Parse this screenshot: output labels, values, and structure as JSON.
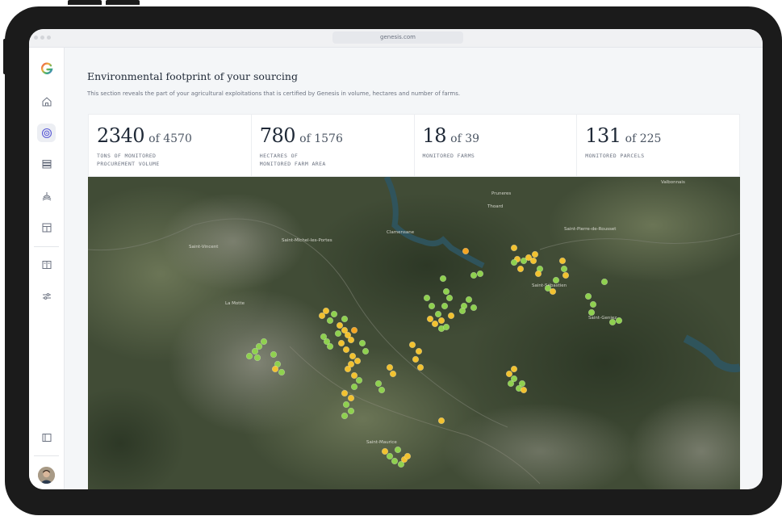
{
  "browser": {
    "url": "genesis.com"
  },
  "brand": {
    "logo": "G",
    "colors": [
      "#e84e4e",
      "#f2b33d",
      "#3bb36b",
      "#4a7bd6"
    ]
  },
  "sidebar": {
    "items": [
      {
        "name": "home",
        "icon": "home-icon",
        "active": false
      },
      {
        "name": "sourcing",
        "icon": "target-icon",
        "active": true
      },
      {
        "name": "suppliers",
        "icon": "list-icon",
        "active": false
      },
      {
        "name": "farms",
        "icon": "field-icon",
        "active": false
      },
      {
        "name": "calendar",
        "icon": "calendar-icon",
        "active": false
      },
      {
        "name": "book",
        "icon": "book-icon",
        "active": false
      },
      {
        "name": "settings",
        "icon": "sliders-icon",
        "active": false
      }
    ],
    "bottom": {
      "collapse_icon": "panel-icon",
      "avatar": "user-avatar"
    }
  },
  "page": {
    "title": "Environmental footprint of your sourcing",
    "subtitle": "This section reveals the part of your agricultural exploitations that is certified by Genesis in volume, hectares and number of farms."
  },
  "stats": [
    {
      "value": "2340",
      "total": "of 4570",
      "label1": "TONS OF MONITORED",
      "label2": "PROCUREMENT VOLUME"
    },
    {
      "value": "780",
      "total": "of 1576",
      "label1": "HECTARES OF",
      "label2": "MONITORED FARM AREA"
    },
    {
      "value": "18",
      "total": "of 39",
      "label1": "MONITORED FARMS",
      "label2": ""
    },
    {
      "value": "131",
      "total": "of 225",
      "label1": "MONITORED PARCELS",
      "label2": ""
    }
  ],
  "map": {
    "colors": {
      "green": "#8fd14f",
      "yellow": "#f2c230",
      "orange": "#f5a623"
    },
    "labels": [
      "Pruneres",
      "Saint-Pierre-de-Rousset",
      "Saint-Michel-les-Portes",
      "Saint-Sébastien",
      "Clamensane",
      "Saint-Geniez",
      "Saint-Vincent",
      "Thoard",
      "Valbonnais",
      "Saint-Maurice",
      "La Motte"
    ]
  }
}
